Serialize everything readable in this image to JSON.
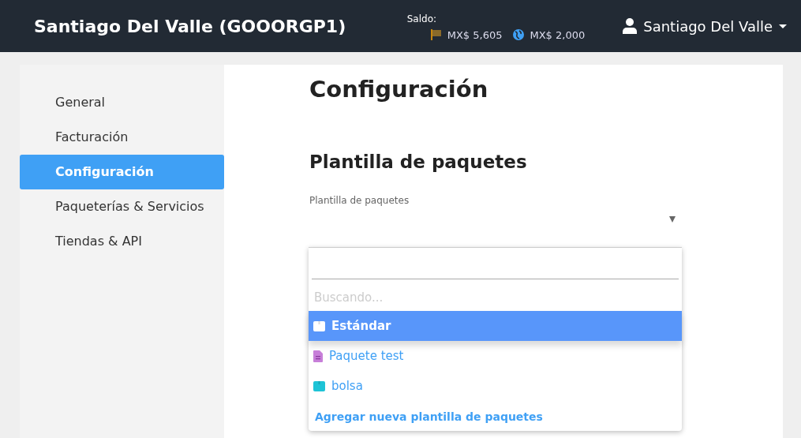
{
  "header": {
    "title": "Santiago Del Valle (GOOORGP1)",
    "balance_label": "Saldo:",
    "balances": [
      {
        "kind": "flag",
        "amount": "MX$ 5,605"
      },
      {
        "kind": "globe",
        "amount": "MX$ 2,000"
      }
    ],
    "user": "Santiago Del Valle"
  },
  "sidebar": {
    "items": [
      {
        "label": "General",
        "selected": false
      },
      {
        "label": "Facturación",
        "selected": false
      },
      {
        "label": "Configuración",
        "selected": true
      },
      {
        "label": "Paqueterías & Servicios",
        "selected": false
      },
      {
        "label": "Tiendas & API",
        "selected": false
      }
    ]
  },
  "main": {
    "title": "Configuración",
    "section_title": "Plantilla de paquetes",
    "field_label": "Plantilla de paquetes",
    "dropdown": {
      "status": "Buscando...",
      "options": [
        {
          "label": "Estándar",
          "kind": "box",
          "color": "#ffffff",
          "selected": true
        },
        {
          "label": "Paquete test",
          "kind": "document",
          "color": "#c77fd9",
          "selected": false
        },
        {
          "label": "bolsa",
          "kind": "box",
          "color": "#1ec3d6",
          "selected": false
        }
      ],
      "add_link": "Agregar nueva plantilla de paquetes"
    }
  }
}
